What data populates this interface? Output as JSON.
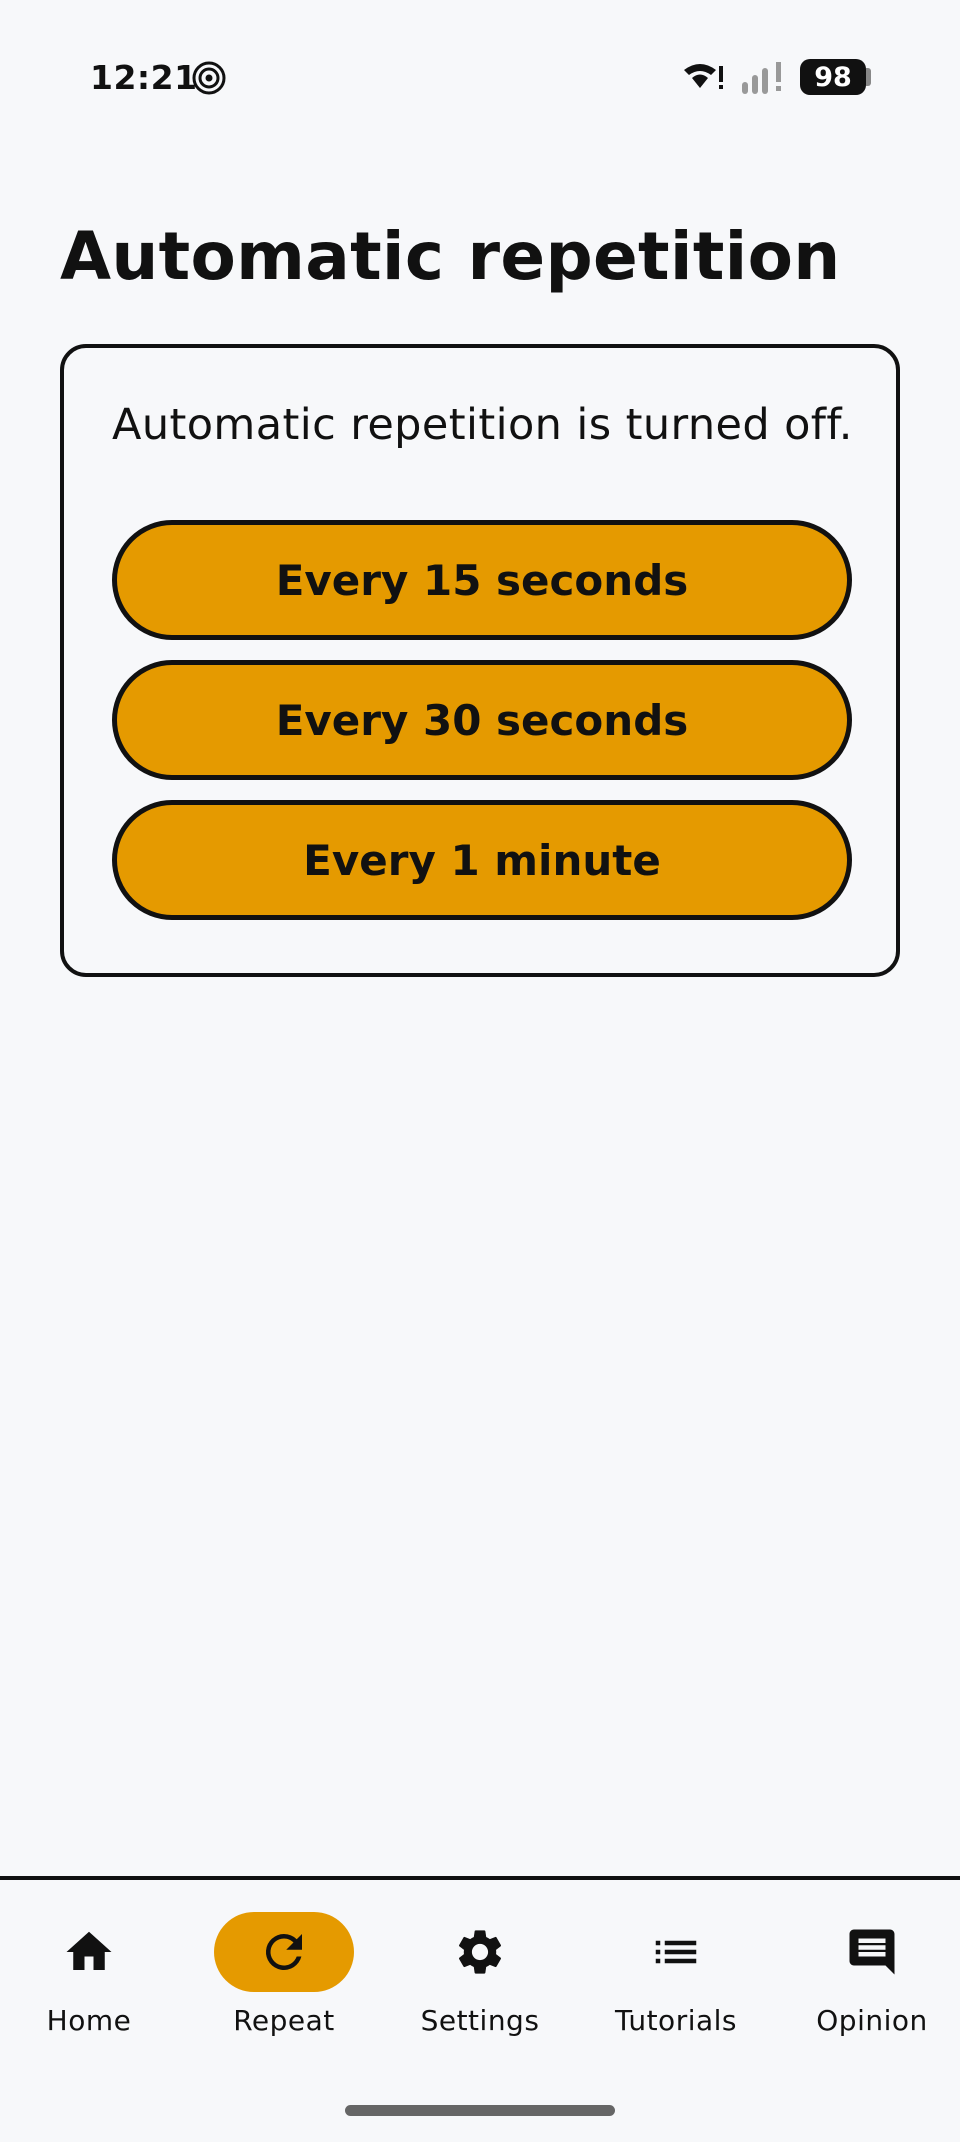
{
  "status_bar": {
    "time": "12:21",
    "battery_level": "98",
    "icons": [
      "focus-mode-icon",
      "wifi-icon",
      "signal-icon",
      "battery-icon"
    ]
  },
  "page": {
    "title": "Automatic repetition"
  },
  "repetition_card": {
    "message": "Automatic repetition is turned off.",
    "options": [
      {
        "label": "Every 15 seconds"
      },
      {
        "label": "Every 30 seconds"
      },
      {
        "label": "Every 1 minute"
      }
    ],
    "button_color": "#e59a00"
  },
  "bottom_nav": {
    "active": "Repeat",
    "items": [
      {
        "label": "Home",
        "icon": "home-icon"
      },
      {
        "label": "Repeat",
        "icon": "repeat-icon"
      },
      {
        "label": "Settings",
        "icon": "gear-icon"
      },
      {
        "label": "Tutorials",
        "icon": "list-icon"
      },
      {
        "label": "Opinion",
        "icon": "chat-icon"
      }
    ]
  }
}
